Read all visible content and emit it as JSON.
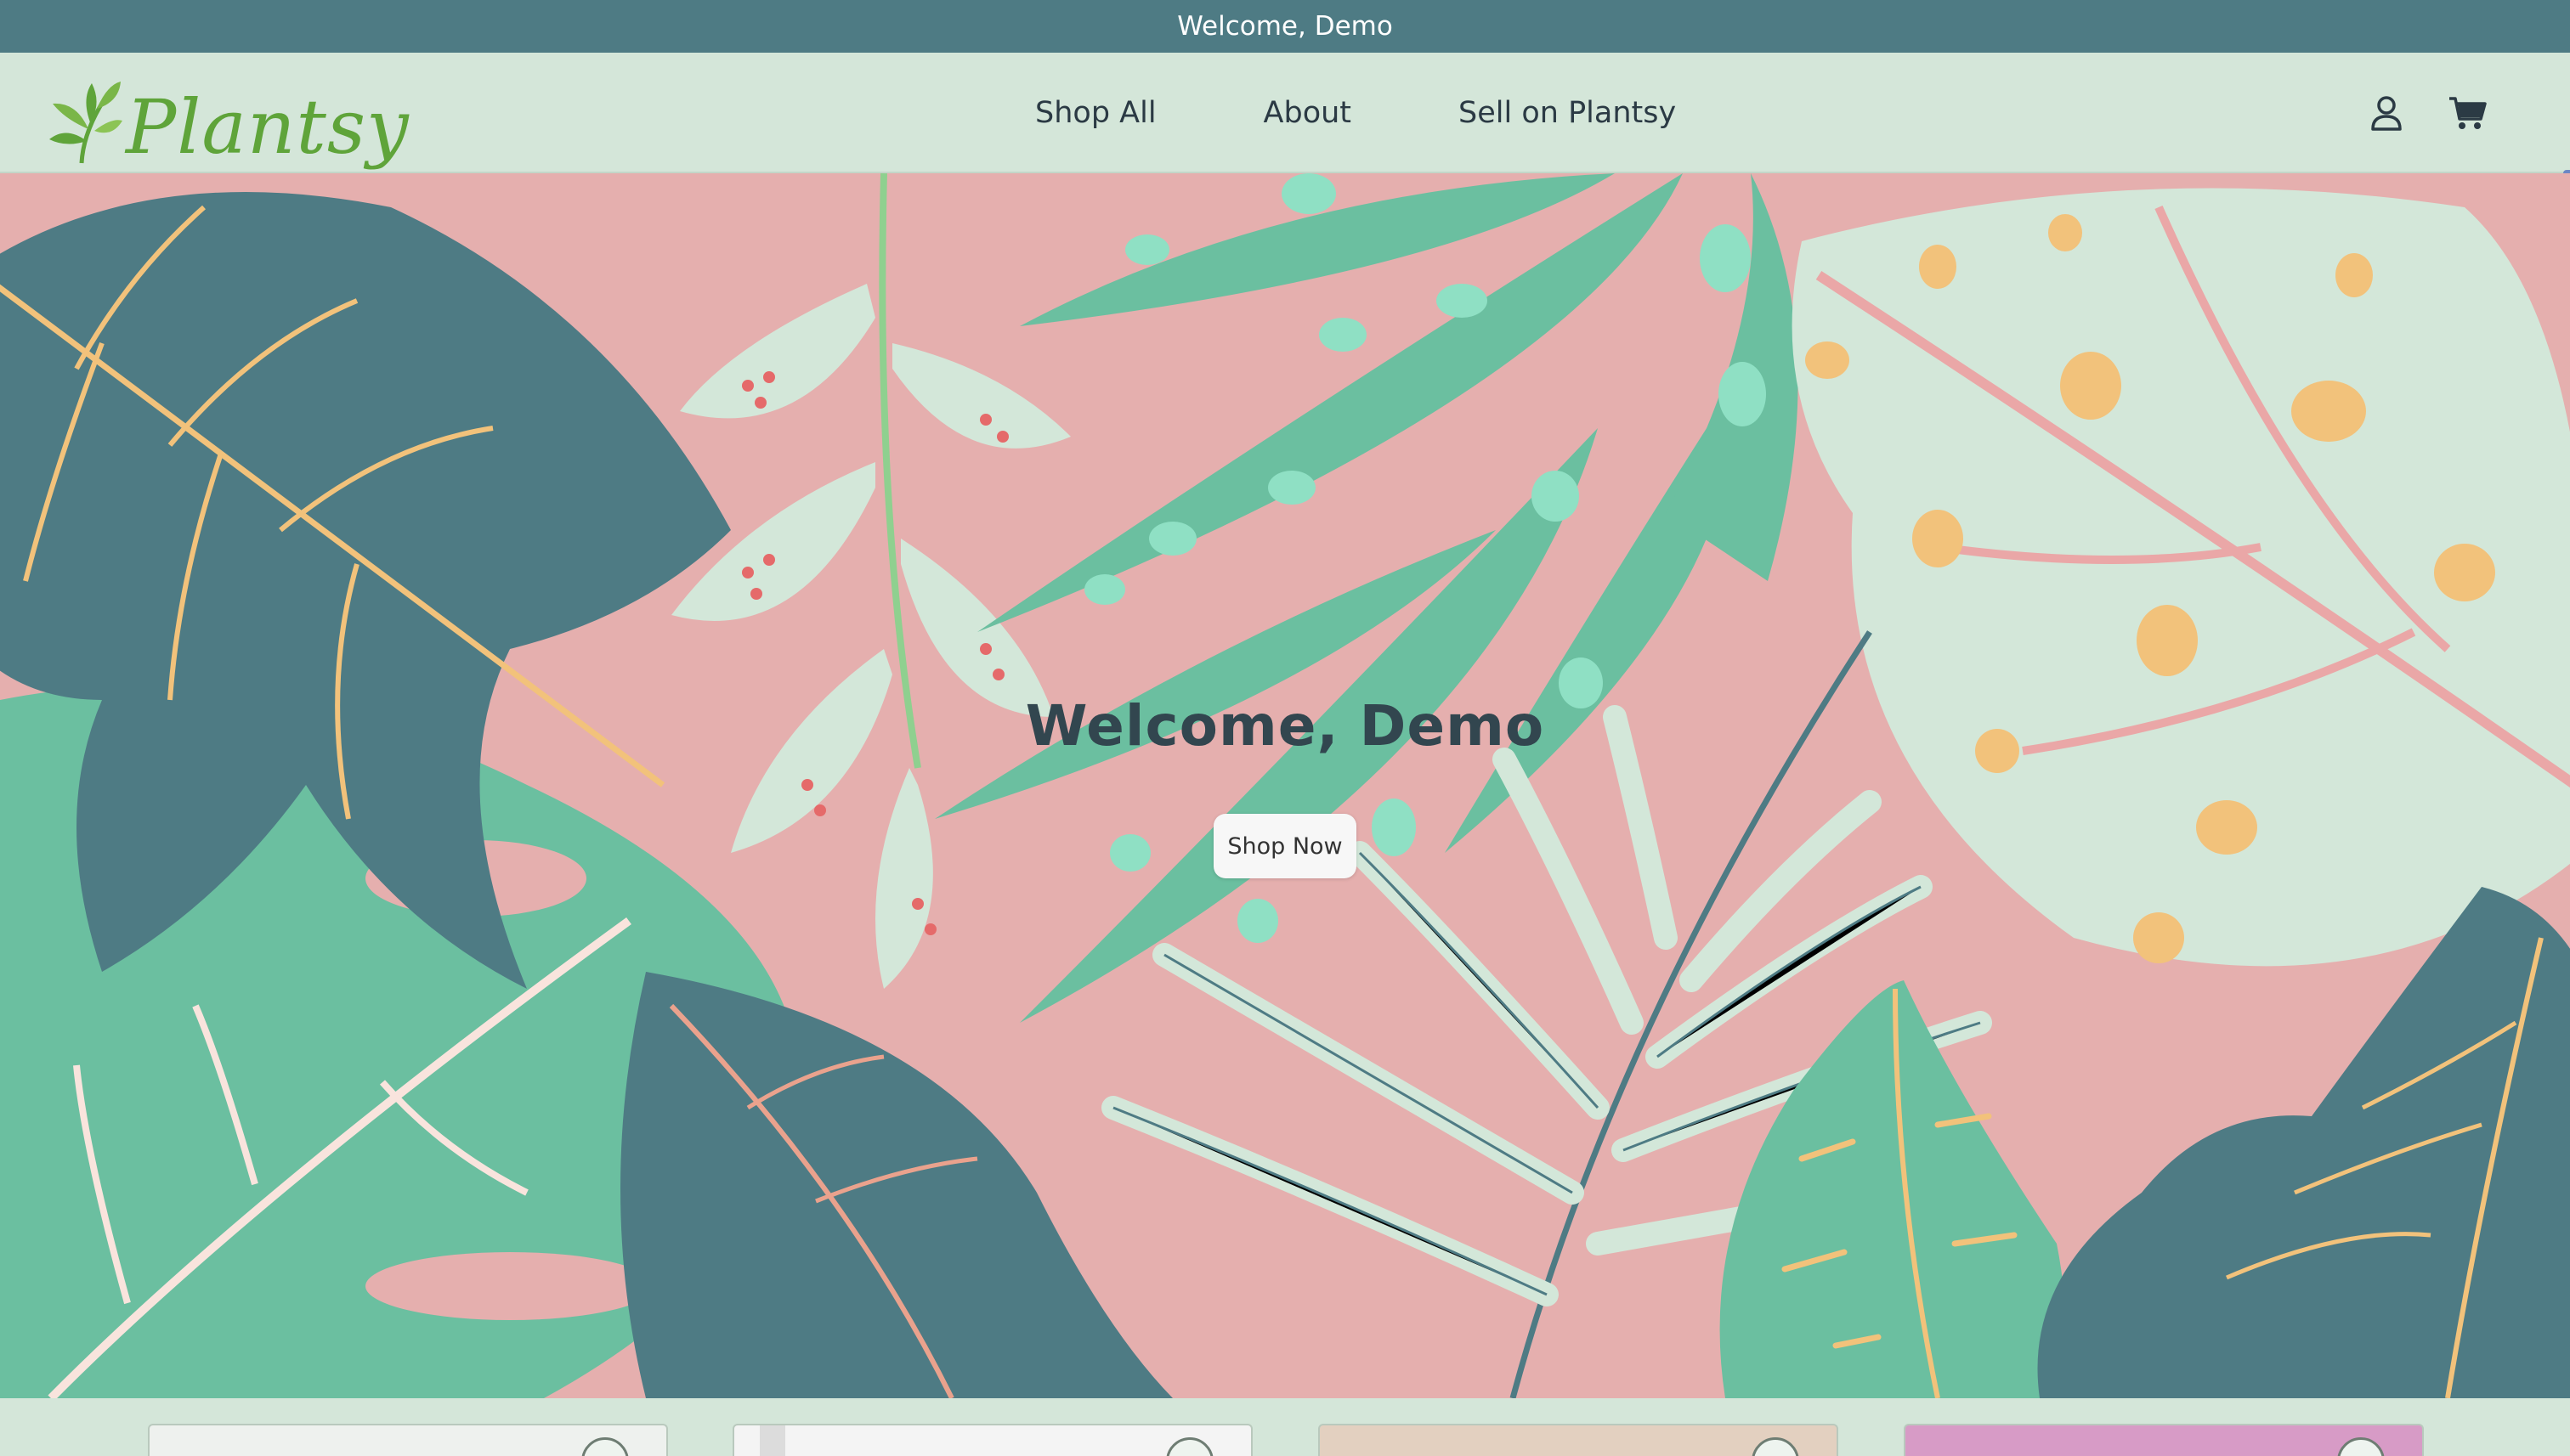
{
  "announcement": {
    "text": "Welcome, Demo"
  },
  "header": {
    "logo_text": "Plantsy",
    "nav": [
      {
        "label": "Shop All"
      },
      {
        "label": "About"
      },
      {
        "label": "Sell on Plantsy"
      }
    ],
    "icons": {
      "account": "user-icon",
      "cart": "cart-icon"
    }
  },
  "hero": {
    "title": "Welcome, Demo",
    "button_label": "Shop Now"
  },
  "product_cards": [
    {
      "image": "plant-photo",
      "favorite_icon": "heart-icon"
    },
    {
      "image": "plant-photo",
      "favorite_icon": "heart-icon"
    },
    {
      "image": "plant-photo",
      "favorite_icon": "heart-icon"
    },
    {
      "image": "plant-photo",
      "favorite_icon": "heart-icon"
    }
  ],
  "colors": {
    "announcement_bg": "#4e7b84",
    "header_bg": "#d4e6d9",
    "hero_bg": "#e5afae",
    "brand_green": "#5fa43a",
    "dark_teal": "#4e7b84",
    "mint": "#6bbfa0",
    "pale_leaf": "#d3e7d9",
    "accent_yellow": "#f2c27b"
  }
}
